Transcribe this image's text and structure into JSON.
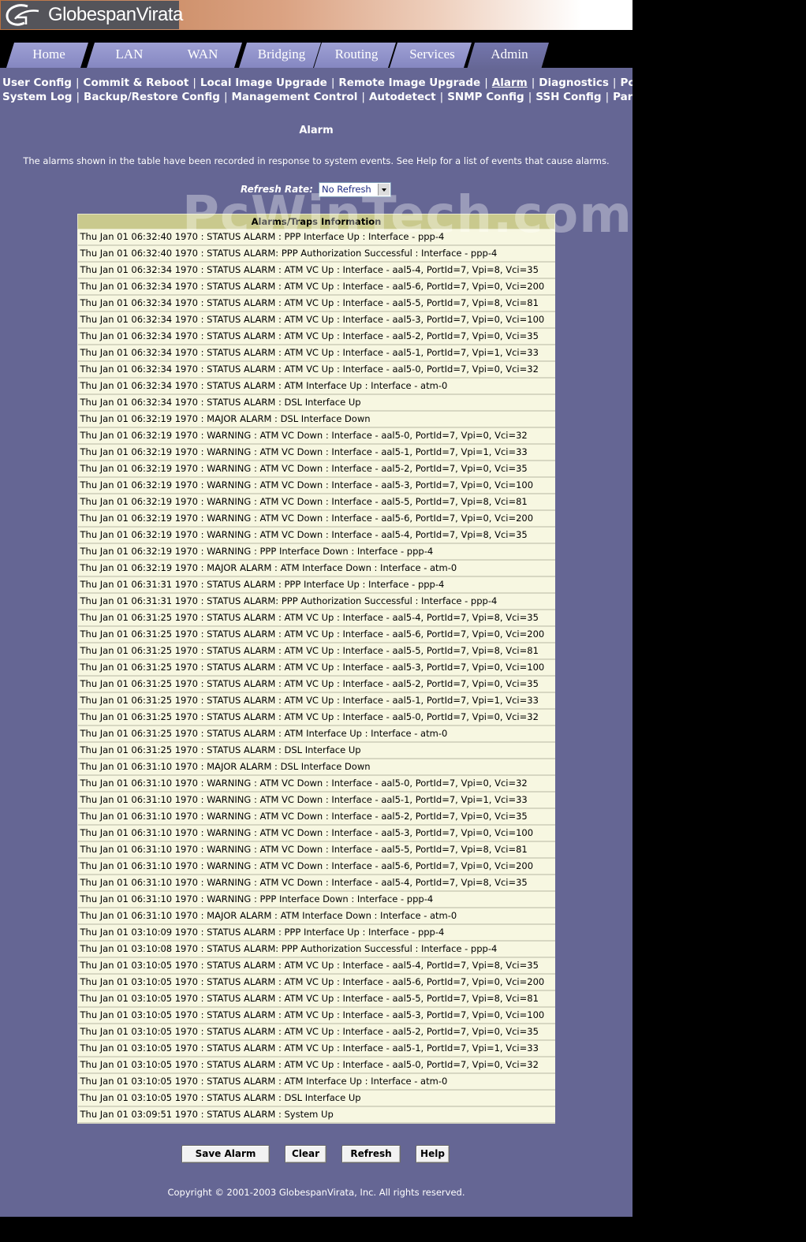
{
  "brand": {
    "name": "GlobespanVirata"
  },
  "tabs": [
    "Home",
    "LAN",
    "WAN",
    "Bridging",
    "Routing",
    "Services",
    "Admin"
  ],
  "active_tab": "Admin",
  "subnav": {
    "row1": [
      "User Config",
      "Commit & Reboot",
      "Local Image Upgrade",
      "Remote Image Upgrade",
      "Alarm",
      "Diagnostics",
      "Port Settings"
    ],
    "row2": [
      "System Log",
      "Backup/Restore Config",
      "Management Control",
      "Autodetect",
      "SNMP Config",
      "SSH Config",
      "Parental Control"
    ],
    "current": "Alarm"
  },
  "page": {
    "title": "Alarm",
    "intro": "The alarms shown in the table have been recorded in response to system events. See Help for a list of events that cause alarms.",
    "refresh_label": "Refresh Rate:",
    "refresh_value": "No Refresh"
  },
  "watermark": "PcWinTech.com",
  "table": {
    "header": "Alarms/Traps Information",
    "rows": [
      "Thu Jan 01 06:32:40 1970 : STATUS ALARM : PPP Interface Up : Interface - ppp-4",
      "Thu Jan 01 06:32:40 1970 : STATUS ALARM: PPP Authorization Successful : Interface - ppp-4",
      "Thu Jan 01 06:32:34 1970 : STATUS ALARM : ATM VC Up : Interface - aal5-4, PortId=7, Vpi=8, Vci=35",
      "Thu Jan 01 06:32:34 1970 : STATUS ALARM : ATM VC Up : Interface - aal5-6, PortId=7, Vpi=0, Vci=200",
      "Thu Jan 01 06:32:34 1970 : STATUS ALARM : ATM VC Up : Interface - aal5-5, PortId=7, Vpi=8, Vci=81",
      "Thu Jan 01 06:32:34 1970 : STATUS ALARM : ATM VC Up : Interface - aal5-3, PortId=7, Vpi=0, Vci=100",
      "Thu Jan 01 06:32:34 1970 : STATUS ALARM : ATM VC Up : Interface - aal5-2, PortId=7, Vpi=0, Vci=35",
      "Thu Jan 01 06:32:34 1970 : STATUS ALARM : ATM VC Up : Interface - aal5-1, PortId=7, Vpi=1, Vci=33",
      "Thu Jan 01 06:32:34 1970 : STATUS ALARM : ATM VC Up : Interface - aal5-0, PortId=7, Vpi=0, Vci=32",
      "Thu Jan 01 06:32:34 1970 : STATUS ALARM : ATM Interface Up : Interface - atm-0",
      "Thu Jan 01 06:32:34 1970 : STATUS ALARM : DSL Interface Up",
      "Thu Jan 01 06:32:19 1970 : MAJOR ALARM : DSL Interface Down",
      "Thu Jan 01 06:32:19 1970 : WARNING : ATM VC Down : Interface - aal5-0, PortId=7, Vpi=0, Vci=32",
      "Thu Jan 01 06:32:19 1970 : WARNING : ATM VC Down : Interface - aal5-1, PortId=7, Vpi=1, Vci=33",
      "Thu Jan 01 06:32:19 1970 : WARNING : ATM VC Down : Interface - aal5-2, PortId=7, Vpi=0, Vci=35",
      "Thu Jan 01 06:32:19 1970 : WARNING : ATM VC Down : Interface - aal5-3, PortId=7, Vpi=0, Vci=100",
      "Thu Jan 01 06:32:19 1970 : WARNING : ATM VC Down : Interface - aal5-5, PortId=7, Vpi=8, Vci=81",
      "Thu Jan 01 06:32:19 1970 : WARNING : ATM VC Down : Interface - aal5-6, PortId=7, Vpi=0, Vci=200",
      "Thu Jan 01 06:32:19 1970 : WARNING : ATM VC Down : Interface - aal5-4, PortId=7, Vpi=8, Vci=35",
      "Thu Jan 01 06:32:19 1970 : WARNING : PPP Interface Down : Interface - ppp-4",
      "Thu Jan 01 06:32:19 1970 : MAJOR ALARM : ATM Interface Down : Interface - atm-0",
      "Thu Jan 01 06:31:31 1970 : STATUS ALARM : PPP Interface Up : Interface - ppp-4",
      "Thu Jan 01 06:31:31 1970 : STATUS ALARM: PPP Authorization Successful : Interface - ppp-4",
      "Thu Jan 01 06:31:25 1970 : STATUS ALARM : ATM VC Up : Interface - aal5-4, PortId=7, Vpi=8, Vci=35",
      "Thu Jan 01 06:31:25 1970 : STATUS ALARM : ATM VC Up : Interface - aal5-6, PortId=7, Vpi=0, Vci=200",
      "Thu Jan 01 06:31:25 1970 : STATUS ALARM : ATM VC Up : Interface - aal5-5, PortId=7, Vpi=8, Vci=81",
      "Thu Jan 01 06:31:25 1970 : STATUS ALARM : ATM VC Up : Interface - aal5-3, PortId=7, Vpi=0, Vci=100",
      "Thu Jan 01 06:31:25 1970 : STATUS ALARM : ATM VC Up : Interface - aal5-2, PortId=7, Vpi=0, Vci=35",
      "Thu Jan 01 06:31:25 1970 : STATUS ALARM : ATM VC Up : Interface - aal5-1, PortId=7, Vpi=1, Vci=33",
      "Thu Jan 01 06:31:25 1970 : STATUS ALARM : ATM VC Up : Interface - aal5-0, PortId=7, Vpi=0, Vci=32",
      "Thu Jan 01 06:31:25 1970 : STATUS ALARM : ATM Interface Up : Interface - atm-0",
      "Thu Jan 01 06:31:25 1970 : STATUS ALARM : DSL Interface Up",
      "Thu Jan 01 06:31:10 1970 : MAJOR ALARM : DSL Interface Down",
      "Thu Jan 01 06:31:10 1970 : WARNING : ATM VC Down : Interface - aal5-0, PortId=7, Vpi=0, Vci=32",
      "Thu Jan 01 06:31:10 1970 : WARNING : ATM VC Down : Interface - aal5-1, PortId=7, Vpi=1, Vci=33",
      "Thu Jan 01 06:31:10 1970 : WARNING : ATM VC Down : Interface - aal5-2, PortId=7, Vpi=0, Vci=35",
      "Thu Jan 01 06:31:10 1970 : WARNING : ATM VC Down : Interface - aal5-3, PortId=7, Vpi=0, Vci=100",
      "Thu Jan 01 06:31:10 1970 : WARNING : ATM VC Down : Interface - aal5-5, PortId=7, Vpi=8, Vci=81",
      "Thu Jan 01 06:31:10 1970 : WARNING : ATM VC Down : Interface - aal5-6, PortId=7, Vpi=0, Vci=200",
      "Thu Jan 01 06:31:10 1970 : WARNING : ATM VC Down : Interface - aal5-4, PortId=7, Vpi=8, Vci=35",
      "Thu Jan 01 06:31:10 1970 : WARNING : PPP Interface Down : Interface - ppp-4",
      "Thu Jan 01 06:31:10 1970 : MAJOR ALARM : ATM Interface Down : Interface - atm-0",
      "Thu Jan 01 03:10:09 1970 : STATUS ALARM : PPP Interface Up : Interface - ppp-4",
      "Thu Jan 01 03:10:08 1970 : STATUS ALARM: PPP Authorization Successful : Interface - ppp-4",
      "Thu Jan 01 03:10:05 1970 : STATUS ALARM : ATM VC Up : Interface - aal5-4, PortId=7, Vpi=8, Vci=35",
      "Thu Jan 01 03:10:05 1970 : STATUS ALARM : ATM VC Up : Interface - aal5-6, PortId=7, Vpi=0, Vci=200",
      "Thu Jan 01 03:10:05 1970 : STATUS ALARM : ATM VC Up : Interface - aal5-5, PortId=7, Vpi=8, Vci=81",
      "Thu Jan 01 03:10:05 1970 : STATUS ALARM : ATM VC Up : Interface - aal5-3, PortId=7, Vpi=0, Vci=100",
      "Thu Jan 01 03:10:05 1970 : STATUS ALARM : ATM VC Up : Interface - aal5-2, PortId=7, Vpi=0, Vci=35",
      "Thu Jan 01 03:10:05 1970 : STATUS ALARM : ATM VC Up : Interface - aal5-1, PortId=7, Vpi=1, Vci=33",
      "Thu Jan 01 03:10:05 1970 : STATUS ALARM : ATM VC Up : Interface - aal5-0, PortId=7, Vpi=0, Vci=32",
      "Thu Jan 01 03:10:05 1970 : STATUS ALARM : ATM Interface Up : Interface - atm-0",
      "Thu Jan 01 03:10:05 1970 : STATUS ALARM : DSL Interface Up",
      "Thu Jan 01 03:09:51 1970 : STATUS ALARM : System Up"
    ]
  },
  "buttons": {
    "save": "Save Alarm",
    "clear": "Clear",
    "refresh": "Refresh",
    "help": "Help"
  },
  "footer": {
    "copyright": "Copyright © 2001-2003 GlobespanVirata, Inc. All rights reserved."
  },
  "colors": {
    "page_bg": "#656694",
    "tab": "#8587c1",
    "table_header": "#c9c98d",
    "table_row": "#f7f7e1"
  }
}
